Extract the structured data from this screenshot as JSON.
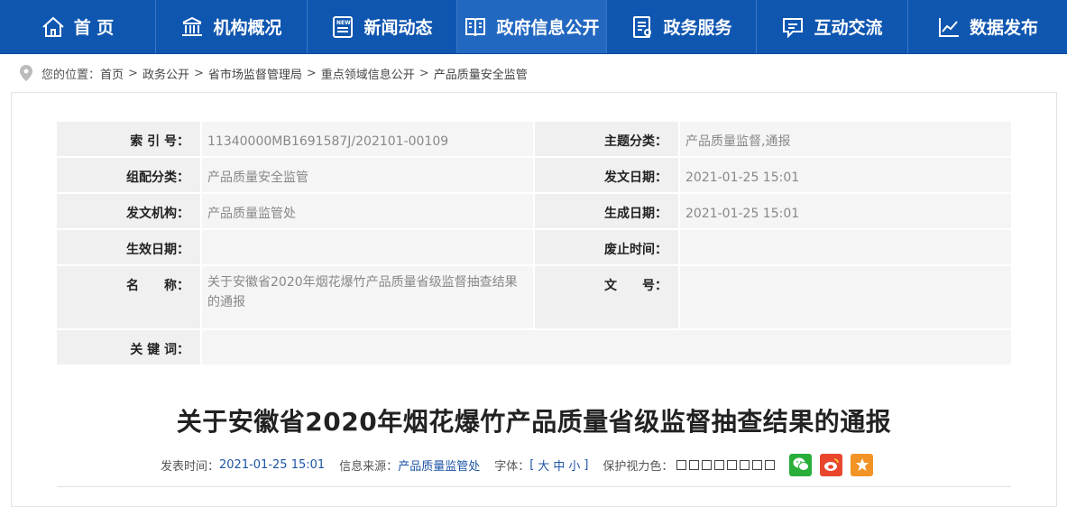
{
  "nav": {
    "items": [
      {
        "label": "首 页",
        "icon": "home-icon"
      },
      {
        "label": "机构概况",
        "icon": "building-icon"
      },
      {
        "label": "新闻动态",
        "icon": "news-icon"
      },
      {
        "label": "政府信息公开",
        "icon": "gov-info-icon"
      },
      {
        "label": "政务服务",
        "icon": "service-icon"
      },
      {
        "label": "互动交流",
        "icon": "chat-icon"
      },
      {
        "label": "数据发布",
        "icon": "chart-line-icon"
      }
    ],
    "active_index": 3,
    "colors": {
      "bar": "#0f56b0",
      "active": "#2368c0"
    }
  },
  "breadcrumb": {
    "prefix": "您的位置：",
    "items": [
      "首页",
      "政务公开",
      "省市场监督管理局",
      "重点领域信息公开",
      "产品质量安全监管"
    ]
  },
  "meta": {
    "index_no": {
      "label": "索 引 号：",
      "value": "11340000MB1691587J/202101-00109"
    },
    "topic": {
      "label": "主题分类：",
      "value": "产品质量监督,通报"
    },
    "category": {
      "label": "组配分类：",
      "value": "产品质量安全监管"
    },
    "issue_date": {
      "label": "发文日期：",
      "value": "2021-01-25 15:01"
    },
    "issuer": {
      "label": "发文机构：",
      "value": "产品质量监管处"
    },
    "created_date": {
      "label": "生成日期：",
      "value": "2021-01-25 15:01"
    },
    "effective_date": {
      "label": "生效日期：",
      "value": ""
    },
    "abolish_time": {
      "label": "废止时间：",
      "value": ""
    },
    "name": {
      "label": "名　　称：",
      "value": "关于安徽省2020年烟花爆竹产品质量省级监督抽查结果的通报"
    },
    "doc_no": {
      "label": "文　　号：",
      "value": ""
    },
    "keywords": {
      "label": "关 键 词：",
      "value": ""
    }
  },
  "article": {
    "title": "关于安徽省2020年烟花爆竹产品质量省级监督抽查结果的通报",
    "publish_label": "发表时间：",
    "publish_time": "2021-01-25 15:01",
    "source_label": "信息来源：",
    "source": "产品质量监管处",
    "font_label": "字体：",
    "font_open": "[",
    "font_large": "大",
    "font_medium": "中",
    "font_small": "小",
    "font_close": "]",
    "eye_label": "保护视力色：",
    "eye_color_count": 8,
    "share_icons": [
      "wechat-icon",
      "weibo-icon",
      "favorite-icon"
    ]
  }
}
